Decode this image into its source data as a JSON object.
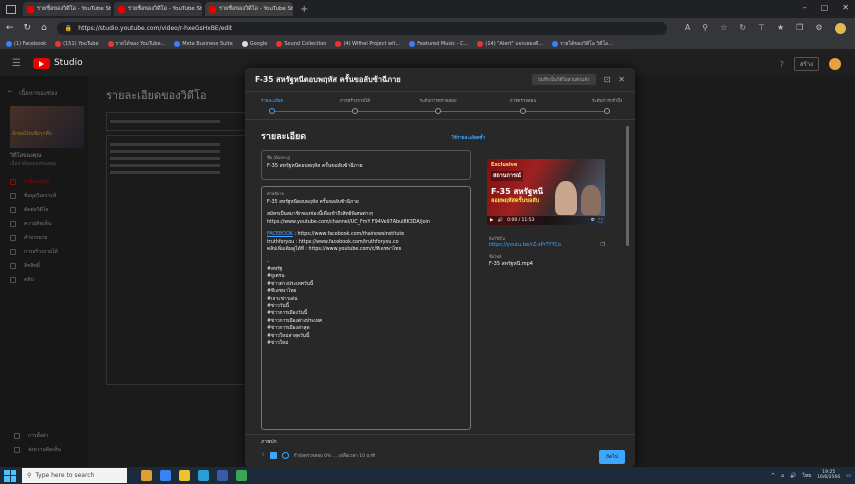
{
  "browser": {
    "tabs": [
      {
        "label": "รายชื่อของวิดีโอ - YouTube Stu",
        "active": false
      },
      {
        "label": "รายชื่อของวิดีโอ - YouTube Stu",
        "active": false
      },
      {
        "label": "รายชื่อของวิดีโอ - YouTube Stu",
        "active": true
      }
    ],
    "url": "https://studio.youtube.com/video/r-hxeGsHxBE/edit",
    "bookmarks": [
      "(1) Facebook",
      "(151) YouTube",
      "รายได้ของ YouTube...",
      "Meta Business Suite",
      "Google",
      "Sound Collection",
      "(4) Wifhei Project wit...",
      "Featured Music - C...",
      "(14) \"Alert\" แจกเพลงดี...",
      "รายได้ของวิดีโอ วิดีโอ..."
    ]
  },
  "studio": {
    "name": "Studio",
    "create_label": "สร้าง",
    "page_title": "รายละเอียดของวิดีโอ",
    "sidebar": {
      "back_label": "เนื้อหาของช่อง",
      "video_title": "วิดีโอของคุณ",
      "video_sub": "เนื้อหาที่เผยแพร่ของคุณ",
      "thumb_caption": "ลักษณ์รัสเซียรุกคืบ",
      "items": [
        {
          "label": "รายละเอียด",
          "active": true
        },
        {
          "label": "ข้อมูลวิเคราะห์",
          "active": false
        },
        {
          "label": "ตัดต่อวิดีโอ",
          "active": false
        },
        {
          "label": "ความคิดเห็น",
          "active": false
        },
        {
          "label": "คำบรรยาย",
          "active": false
        },
        {
          "label": "การสร้างรายได้",
          "active": false
        },
        {
          "label": "ลิขสิทธิ์",
          "active": false
        },
        {
          "label": "คลิป",
          "active": false
        }
      ],
      "bottom": [
        "การตั้งค่า",
        "ส่งความคิดเห็น"
      ]
    }
  },
  "modal": {
    "title": "F-35 สหรัฐหนีตอบพฤหัส ครั้นขอลับซ้าฉีภาย",
    "badge": "บันทึกเป็นวิดีโอส่วนตัวแล้ว",
    "steps": [
      {
        "label": "รายละเอียด",
        "active": true
      },
      {
        "label": "การสร้างรายได้",
        "active": false
      },
      {
        "label": "ระดับการตรวจสอบ",
        "active": false
      },
      {
        "label": "การตรวจสอบ",
        "active": false
      },
      {
        "label": "ระดับการเข้าถึง",
        "active": false
      }
    ],
    "section_title": "รายละเอียด",
    "reuse_link": "ใช้รายละเอียดซ้ำ",
    "title_field": {
      "label": "ชื่อ (ต้องระบุ)",
      "value": "F-35 สหรัฐหนีตอบพฤหัส ครั้นขอลับซ้าฉีภาย"
    },
    "desc_field": {
      "label": "คำอธิบาย",
      "line1": "F-35 สหรัฐหนีตอบพฤหัส ครั้นขอลับซ้าฉีภาย",
      "line2": "สมัครเป็นสมาชิกของช่องนี้เพื่อเข้าถึงสิทธิพิเศษต่างๆ",
      "line3": "https://www.youtube.com/channel/UC_FmY F94Ve97AbuI8K3DA/join",
      "fb_label": "FACEBOOK",
      "fb_url": " : https://www.facebook.com/thainowsinstitute",
      "tfy": "truthforyou : https://www.facebook.com/truthforyou.co",
      "more": "คลิปเพิ่มเติมดูได้ที่ : https://www.youtube.com/c/ทีเอชพาไทย",
      "tags": "-\n#สหรัฐ\n#ยูเครน\n#ข่าวต่างประเทศวันนี้\n#ทีเอชพาไทย\n#เจาะข่าวเด่น\n#ข่าววันนี้\n#ข่าวการเมืองวันนี้\n#ข่าวการเมืองต่างประเทศ\n#ข่าวการเมืองล่าสุด\n#ข่าวใหม่ล่าสุดวันนี้\n#ข่าวใหม่"
    },
    "preview": {
      "thumb_top": "Exclusive",
      "thumb_main": "สถานการณ์",
      "thumb_big": "F-35 สหรัฐหนี",
      "thumb_sub": "ลอยพฤหัสครั้นขอลับ",
      "time": "0:00 / 11:53",
      "link_label": "ลิงก์วิดีโอ",
      "link_value": "https://youtu.be/rZ-zPrTYYCo",
      "file_label": "ชื่อไฟล์",
      "file_value": "F-35 สหรัฐหนี.mp4"
    },
    "tags_label": "ภาพปก",
    "footer_status": "กำลังตรวจสอบ 0% ... เหลือเวลา 10 นาที",
    "next_label": "ถัดไป"
  },
  "taskbar": {
    "search_placeholder": "Type here to search",
    "time": "19:25",
    "date": "16/6/2566"
  }
}
